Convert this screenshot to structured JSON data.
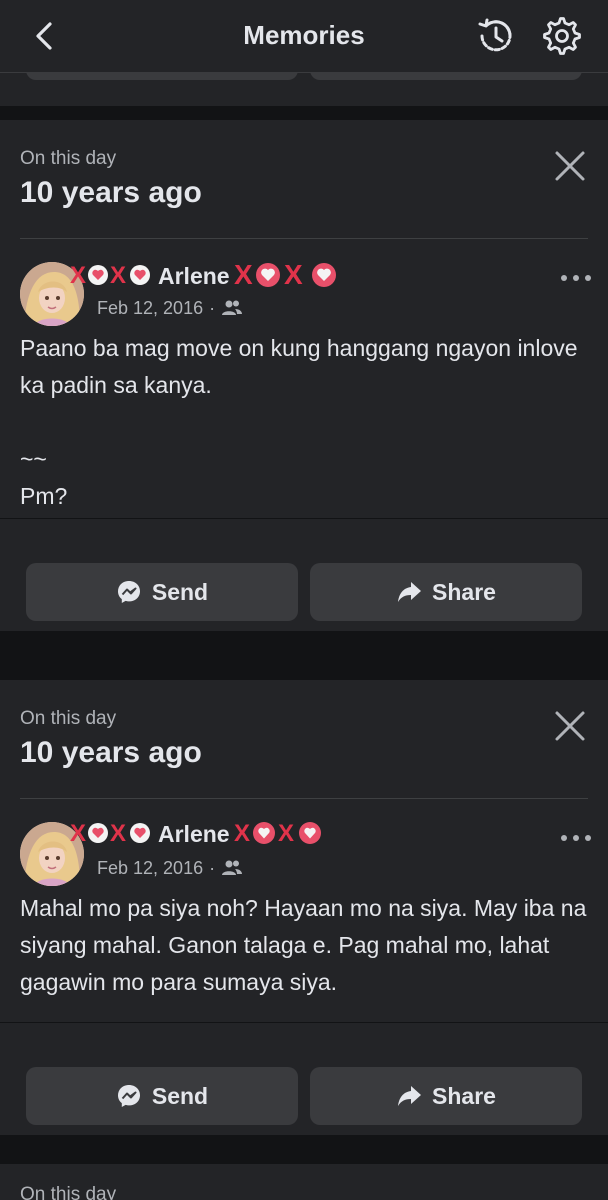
{
  "header": {
    "title": "Memories",
    "back_icon": "chevron-left-icon",
    "history_icon": "history-icon",
    "settings_icon": "gear-icon"
  },
  "memories": [
    {
      "label": "On this day",
      "years_ago": "10 years ago",
      "author": "Arlene",
      "date": "Feb 12, 2016",
      "audience_icon": "friends-icon",
      "text": "Paano ba mag move on kung hanggang ngayon inlove ka padin sa kanya.\n\n~~\nPm?",
      "send_label": "Send",
      "share_label": "Share"
    },
    {
      "label": "On this day",
      "years_ago": "10 years ago",
      "author": "Arlene",
      "date": "Feb 12, 2016",
      "audience_icon": "friends-icon",
      "text": "Mahal mo pa siya noh? Hayaan mo na siya. May iba na siyang mahal. Ganon talaga e. Pag mahal mo, lahat gagawin mo para sumaya siya.",
      "send_label": "Send",
      "share_label": "Share"
    }
  ],
  "colors": {
    "background": "#121315",
    "card": "#232427",
    "button": "#3a3b3e",
    "text_primary": "#e4e6eb",
    "text_secondary": "#b0b3b8",
    "sticker_x": "#e0334a",
    "sticker_heart": "#e8506a"
  }
}
